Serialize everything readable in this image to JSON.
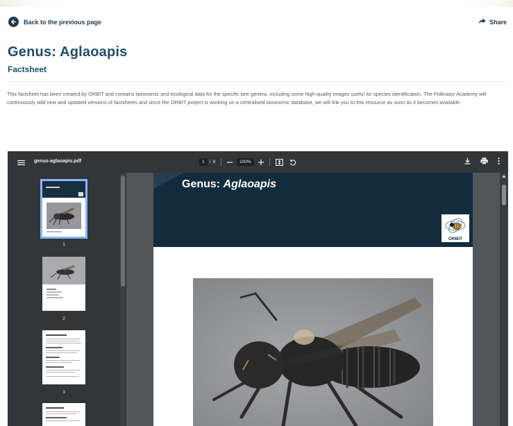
{
  "nav": {
    "back_label": "Back to the previous page",
    "share_label": "Share"
  },
  "header": {
    "title": "Genus: Aglaoapis",
    "subtitle": "Factsheet"
  },
  "description": "This factsheet has been created by ORBIT and contains taxonomic and ecological data for the specific bee genera, including some high-quality images useful for species identification. The Pollinator Academy will continuously add new and updated versions of factsheets and since the ORBIT project is working on a centralised taxonomic database, we will link you to this resource as soon as it becomes available.",
  "viewer": {
    "filename": "genus-aglaoapis.pdf",
    "current_page": "1",
    "page_sep": "/",
    "total_pages": "9",
    "zoom": "100%",
    "thumbnails": [
      {
        "label": "1",
        "selected": true
      },
      {
        "label": "2",
        "selected": false
      },
      {
        "label": "3",
        "selected": false
      },
      {
        "label": "",
        "selected": false
      }
    ],
    "page": {
      "title_prefix": "Genus: ",
      "title_genus": "Aglaoapis",
      "logo_text": "ORBIT"
    }
  },
  "colors": {
    "brand": "#1e4d6b",
    "viewer_toolbar": "#323639",
    "viewer_bg": "#525659",
    "doc_header": "#132c3d",
    "thumb_select": "#8ab4f8"
  },
  "icons": {
    "back": "arrow-left-circle-icon",
    "share": "share-arrow-icon",
    "menu": "hamburger-icon",
    "fit": "fit-page-icon",
    "rotate": "rotate-icon",
    "download": "download-icon",
    "print": "print-icon",
    "more": "more-vert-icon"
  }
}
